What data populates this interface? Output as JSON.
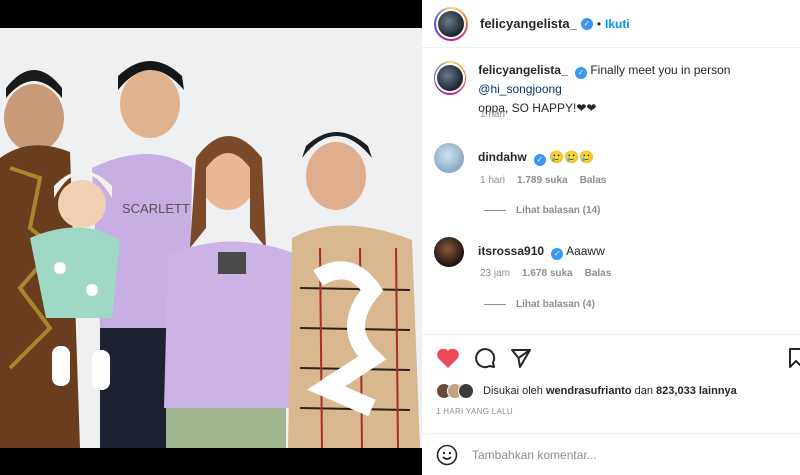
{
  "post": {
    "username": "felicyangelista_",
    "follow_label": "Ikuti",
    "dot": "•",
    "verified_glyph": "✓"
  },
  "caption": {
    "username": "felicyangelista_",
    "text_line1": "Finally meet you in person",
    "mention": "@hi_songjoong",
    "text_line2": "oppa, SO HAPPY!❤❤",
    "time": "1 hari"
  },
  "comments": [
    {
      "username": "dindahw",
      "text": "🥲🥲🥲",
      "time": "1 hari",
      "likes": "1.789 suka",
      "reply": "Balas",
      "view_replies": "Lihat balasan (14)"
    },
    {
      "username": "itsrossa910",
      "text": "Aaaww",
      "time": "23 jam",
      "likes": "1.678 suka",
      "reply": "Balas",
      "view_replies": "Lihat balasan (4)"
    }
  ],
  "actions": {
    "icons": [
      "heart-icon",
      "comment-icon",
      "share-icon",
      "bookmark-icon"
    ],
    "liked_prefix": "Disukai oleh",
    "liked_user": "wendrasufrianto",
    "liked_mid": "dan",
    "liked_count": "823,033",
    "liked_suffix": "lainnya",
    "post_time": "1 HARI YANG LALU"
  },
  "add_comment": {
    "placeholder": "Tambahkan komentar..."
  },
  "colors": {
    "verified": "#3897f0",
    "follow": "#0095f6",
    "liked_heart": "#ed4956"
  }
}
